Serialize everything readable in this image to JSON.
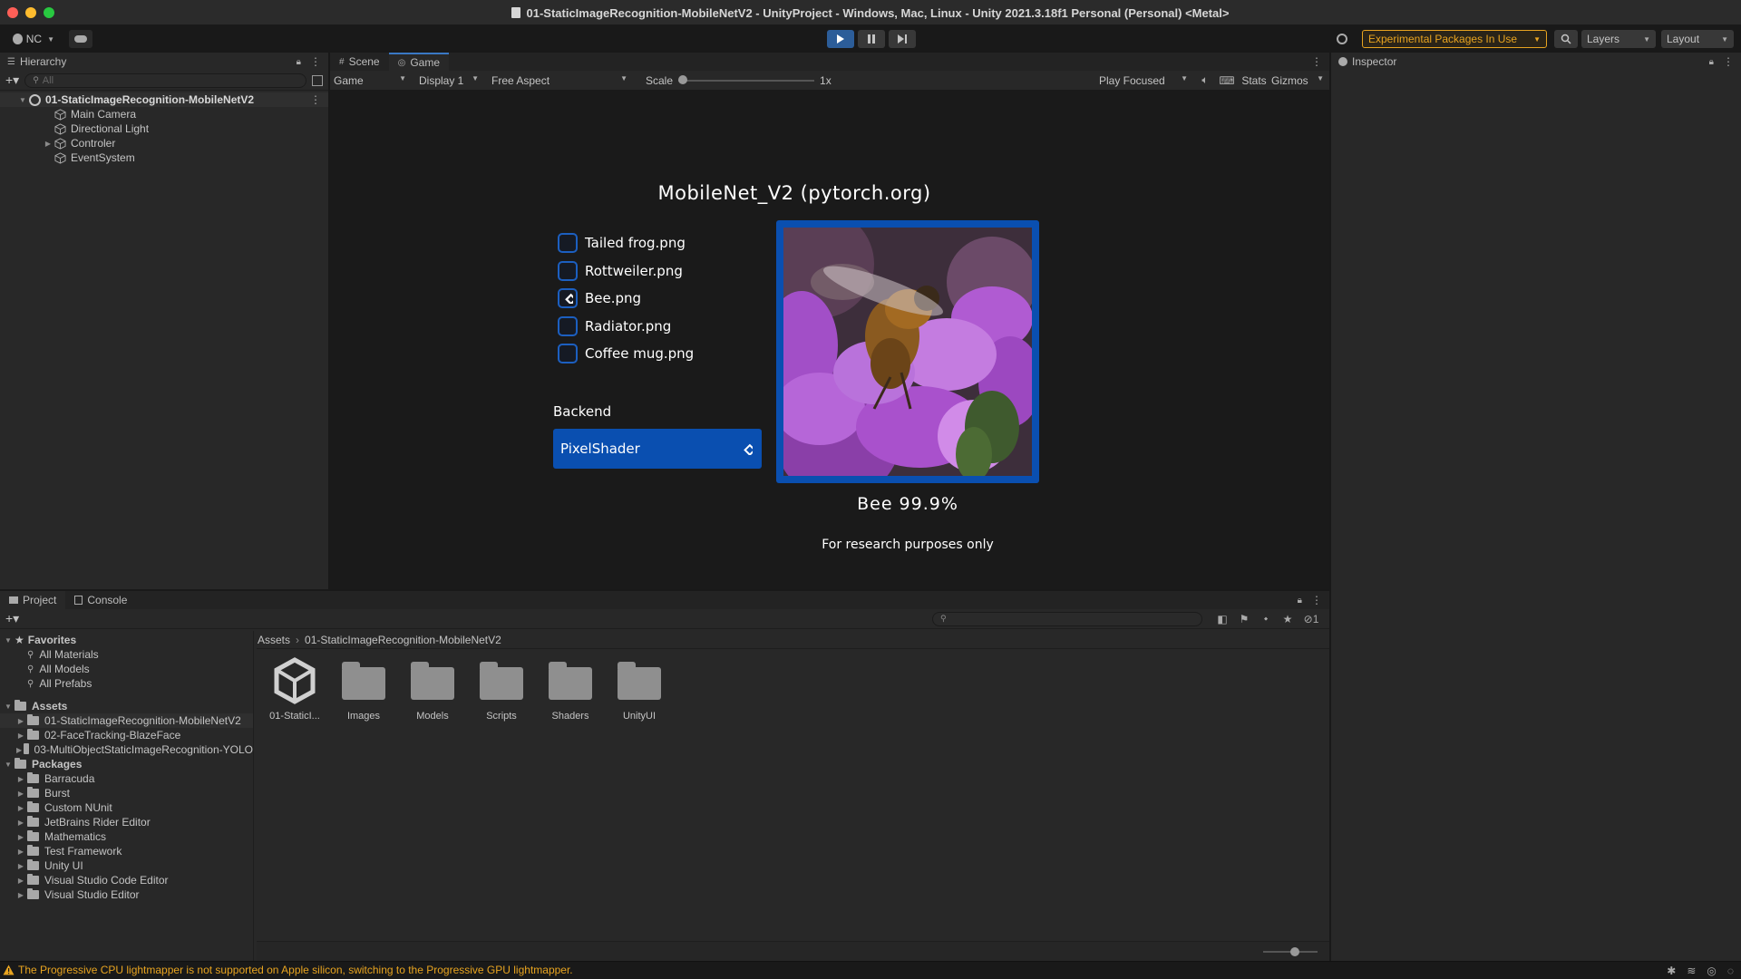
{
  "window": {
    "title": "01-StaticImageRecognition-MobileNetV2 - UnityProject - Windows, Mac, Linux - Unity 2021.3.18f1 Personal (Personal) <Metal>"
  },
  "toolbar": {
    "account_label": "NC",
    "experimental_label": "Experimental Packages In Use",
    "layers_label": "Layers",
    "layout_label": "Layout"
  },
  "hierarchy": {
    "tab_label": "Hierarchy",
    "search_placeholder": "All",
    "scene_name": "01-StaticImageRecognition-MobileNetV2",
    "items": [
      {
        "label": "Main Camera",
        "has_children": false
      },
      {
        "label": "Directional Light",
        "has_children": false
      },
      {
        "label": "Controler",
        "has_children": true
      },
      {
        "label": "EventSystem",
        "has_children": false
      }
    ]
  },
  "view_tabs": {
    "scene_label": "Scene",
    "game_label": "Game"
  },
  "game_toolbar": {
    "view_select": "Game",
    "display_select": "Display 1",
    "aspect_select": "Free Aspect",
    "scale_label": "Scale",
    "scale_value": "1x",
    "scale_fraction": 0.0,
    "play_mode_select": "Play Focused",
    "stats_label": "Stats",
    "gizmos_label": "Gizmos"
  },
  "game": {
    "title": "MobileNet_V2 (pytorch.org)",
    "options": [
      {
        "label": "Tailed frog.png",
        "selected": false
      },
      {
        "label": "Rottweiler.png",
        "selected": false
      },
      {
        "label": "Bee.png",
        "selected": true
      },
      {
        "label": "Radiator.png",
        "selected": false
      },
      {
        "label": "Coffee mug.png",
        "selected": false
      }
    ],
    "backend_label": "Backend",
    "backend_value": "PixelShader",
    "prediction": "Bee 99.9%",
    "disclaimer": "For research purposes only",
    "accent_color": "#0a4fb0"
  },
  "inspector": {
    "tab_label": "Inspector"
  },
  "project": {
    "project_tab": "Project",
    "console_tab": "Console",
    "favorites_label": "Favorites",
    "favorites": [
      "All Materials",
      "All Models",
      "All Prefabs"
    ],
    "assets_label": "Assets",
    "assets": [
      "01-StaticImageRecognition-MobileNetV2",
      "02-FaceTracking-BlazeFace",
      "03-MultiObjectStaticImageRecognition-YOLO"
    ],
    "packages_label": "Packages",
    "packages": [
      "Barracuda",
      "Burst",
      "Custom NUnit",
      "JetBrains Rider Editor",
      "Mathematics",
      "Test Framework",
      "Unity UI",
      "Visual Studio Code Editor",
      "Visual Studio Editor"
    ],
    "breadcrumb_root": "Assets",
    "breadcrumb_current": "01-StaticImageRecognition-MobileNetV2",
    "hidden_count": "1",
    "grid_items": [
      {
        "label": "01-StaticI...",
        "kind": "unity-scene"
      },
      {
        "label": "Images",
        "kind": "folder"
      },
      {
        "label": "Models",
        "kind": "folder"
      },
      {
        "label": "Scripts",
        "kind": "folder"
      },
      {
        "label": "Shaders",
        "kind": "folder"
      },
      {
        "label": "UnityUI",
        "kind": "folder"
      }
    ]
  },
  "status": {
    "message": "The Progressive CPU lightmapper is not supported on Apple silicon, switching to the Progressive GPU lightmapper.",
    "warning_color": "#e8a420"
  }
}
